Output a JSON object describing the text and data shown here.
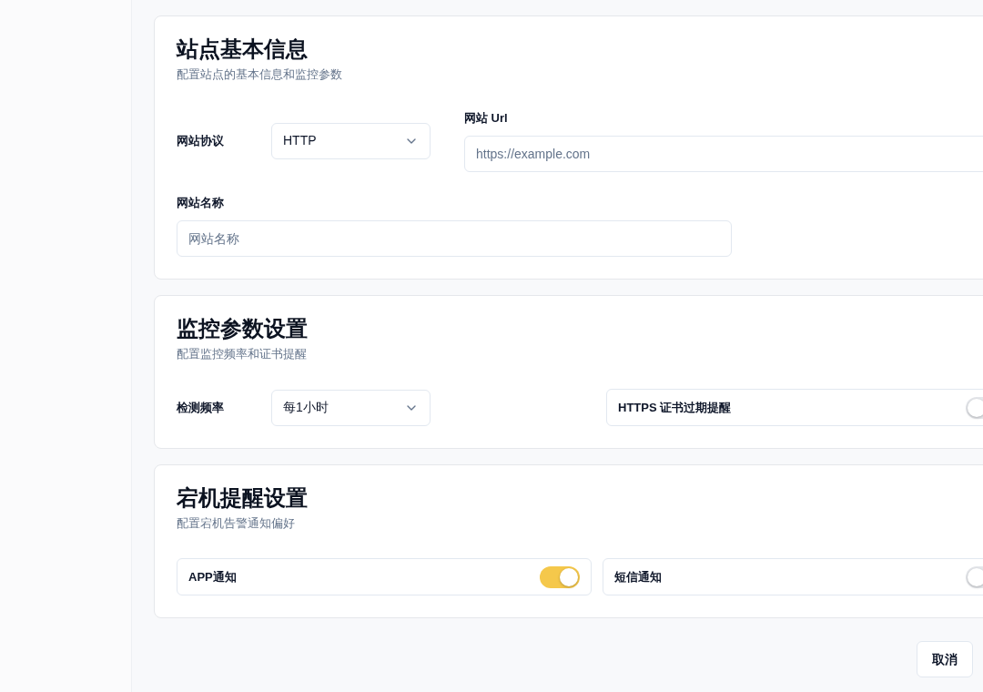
{
  "sections": [
    {
      "title": "站点基本信息",
      "subtitle": "配置站点的基本信息和监控参数",
      "rows": [
        {
          "fields": [
            {
              "kind": "select",
              "label": "网站协议",
              "value": "HTTP"
            },
            {
              "kind": "input",
              "label": "网站 Url",
              "placeholder": "https://example.com"
            }
          ]
        },
        {
          "fields": [
            {
              "kind": "input",
              "label": "网站名称",
              "placeholder": "网站名称"
            }
          ]
        }
      ]
    },
    {
      "title": "监控参数设置",
      "subtitle": "配置监控频率和证书提醒",
      "rows": [
        {
          "fields": [
            {
              "kind": "select",
              "label": "检测频率",
              "value": "每1小时"
            },
            {
              "kind": "toggle",
              "label": "HTTPS 证书过期提醒",
              "on": false
            }
          ]
        }
      ]
    },
    {
      "title": "宕机提醒设置",
      "subtitle": "配置宕机告警通知偏好",
      "rows": [
        {
          "fields": [
            {
              "kind": "toggle",
              "label": "APP通知",
              "on": true
            },
            {
              "kind": "toggle",
              "label": "短信通知",
              "on": false
            }
          ]
        }
      ]
    }
  ],
  "actions": [
    {
      "label": "取消"
    }
  ]
}
